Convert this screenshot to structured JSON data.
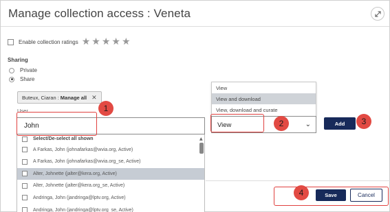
{
  "dialog": {
    "title": "Manage collection access : Veneta",
    "ratings_label": "Enable collection ratings",
    "sharing_label": "Sharing",
    "sharing_options": [
      {
        "label": "Private",
        "selected": false
      },
      {
        "label": "Share",
        "selected": true
      }
    ],
    "chip": {
      "name": "Buteux, Ciaran :",
      "role": "Manage all",
      "close": "✕"
    },
    "user_label": "User",
    "user_input_value": "John",
    "user_list": {
      "select_all_label": "Select/De-select all shown",
      "items": [
        "A Farkas, John (johnafarkas@wvia.org, Active)",
        "A Farkas, John (johnafarkas@wvia.org_se, Active)",
        "Alter, Johnette (jalter@kera.org, Active)",
        "Alter, Johnette (jalter@kera.org_se, Active)",
        "Andringa, John (jandringa@lptv.org, Active)",
        "Andringa, John (jandringa@lptv.org_se, Active)"
      ],
      "highlighted_index": 2
    },
    "permission_menu": {
      "options": [
        "View",
        "View and download",
        "View, download and curate"
      ],
      "selected_index": 1
    },
    "permission_select_value": "View",
    "add_label": "Add",
    "save_label": "Save",
    "cancel_label": "Cancel",
    "badges": [
      "1",
      "2",
      "3",
      "4"
    ],
    "colors": {
      "primary": "#172a5a",
      "annotation": "#e24a43",
      "highlight": "#c6ccd4"
    }
  }
}
